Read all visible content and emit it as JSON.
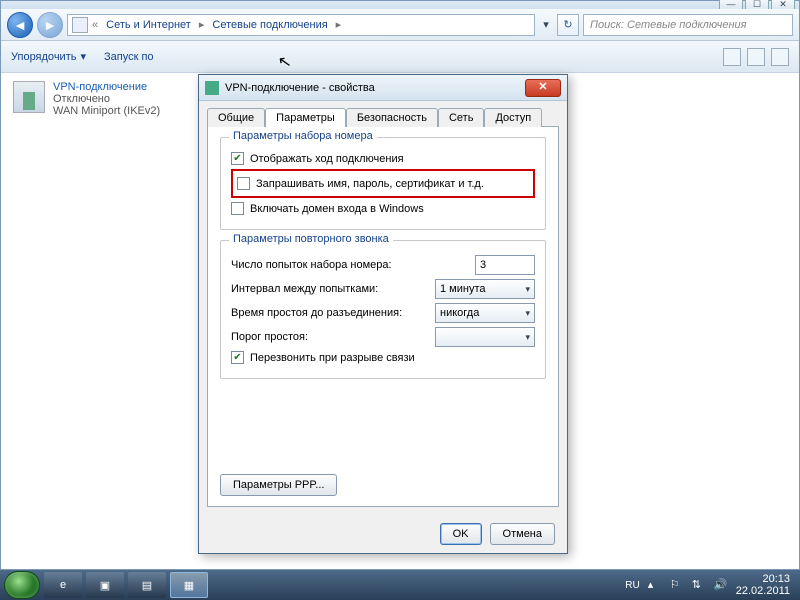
{
  "explorer": {
    "breadcrumb": {
      "root_sep": "«",
      "level1": "Сеть и Интернет",
      "level2": "Сетевые подключения"
    },
    "search_placeholder": "Поиск: Сетевые подключения",
    "toolbar": {
      "organize": "Упорядочить",
      "start": "Запуск по"
    },
    "item": {
      "name": "VPN-подключение",
      "status": "Отключено",
      "type": "WAN Miniport (IKEv2)"
    }
  },
  "dialog": {
    "title": "VPN-подключение - свойства",
    "tabs": {
      "general": "Общие",
      "params": "Параметры",
      "security": "Безопасность",
      "network": "Сеть",
      "access": "Доступ"
    },
    "group1": {
      "legend": "Параметры набора номера",
      "show_progress": "Отображать ход подключения",
      "prompt_creds": "Запрашивать имя, пароль, сертификат и т.д.",
      "include_domain": "Включать домен входа в Windows"
    },
    "group2": {
      "legend": "Параметры повторного звонка",
      "redial_attempts_label": "Число попыток набора номера:",
      "redial_attempts_value": "3",
      "interval_label": "Интервал между попытками:",
      "interval_value": "1 минута",
      "idle_label": "Время простоя до разъединения:",
      "idle_value": "никогда",
      "threshold_label": "Порог простоя:",
      "threshold_value": "",
      "redial_on_drop": "Перезвонить при разрыве связи"
    },
    "ppp_button": "Параметры PPP...",
    "ok": "OK",
    "cancel": "Отмена"
  },
  "taskbar": {
    "lang": "RU",
    "time": "20:13",
    "date": "22.02.2011"
  }
}
